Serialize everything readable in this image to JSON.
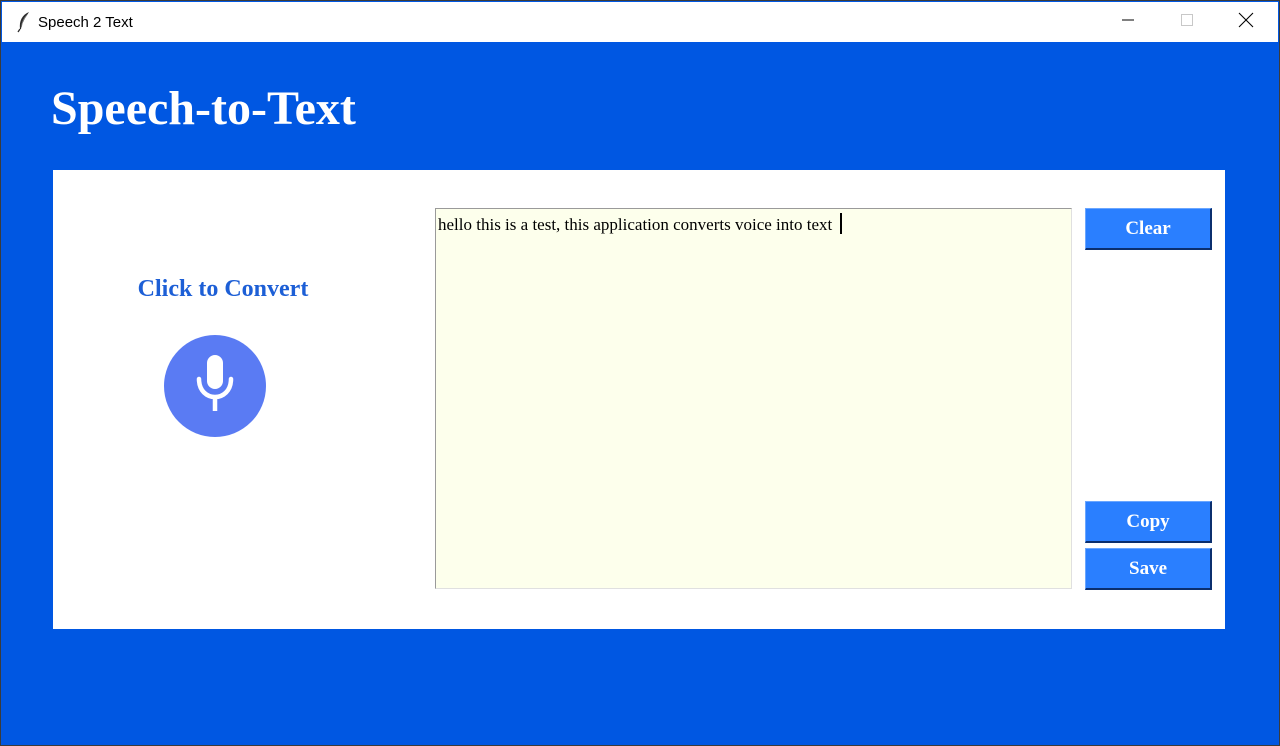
{
  "window": {
    "title": "Speech 2 Text",
    "controls": [
      "minimize-icon",
      "maximize-icon",
      "close-icon"
    ]
  },
  "header": {
    "title": "Speech-to-Text"
  },
  "panel": {
    "convert_label": "Click to Convert",
    "mic_icon": "microphone-icon",
    "transcript": "hello this is a test, this application converts voice into text ",
    "buttons": {
      "clear": "Clear",
      "copy": "Copy",
      "save": "Save"
    }
  },
  "colors": {
    "background": "#0057e2",
    "button": "#2a7fff",
    "mic": "#5a7bf3",
    "label": "#1d5fd6",
    "textarea": "#fdffec"
  }
}
